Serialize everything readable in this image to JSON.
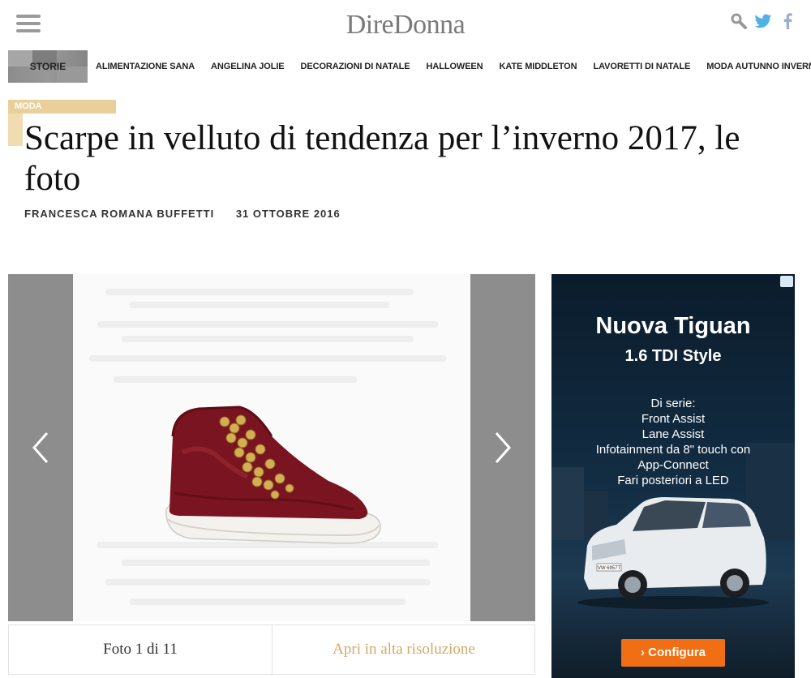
{
  "header": {
    "logo": "DireDonna",
    "icons": [
      "menu-icon",
      "search-icon",
      "twitter-icon",
      "facebook-icon"
    ]
  },
  "nav": {
    "storie": "STORIE",
    "items": [
      "ALIMENTAZIONE SANA",
      "ANGELINA JOLIE",
      "DECORAZIONI DI NATALE",
      "HALLOWEEN",
      "KATE MIDDLETON",
      "LAVORETTI DI NATALE",
      "MODA AUTUNNO INVERNO"
    ]
  },
  "article": {
    "category": "MODA",
    "title": "Scarpe in velluto di tendenza per l’inverno 2017, le foto",
    "author": "FRANCESCA ROMANA BUFFETTI",
    "date": "31 OTTOBRE 2016"
  },
  "gallery": {
    "counter": "Foto 1 di 11",
    "hires": "Apri in alta risoluzione"
  },
  "ad": {
    "title": "Nuova Tiguan",
    "subtitle": "1.6 TDI Style",
    "lines": [
      "Di serie:",
      "Front Assist",
      "Lane Assist",
      "Infotainment da 8\" touch con",
      "App-Connect",
      "Fari posteriori a LED"
    ],
    "plate": "VW 6957T",
    "cta": "Configura"
  },
  "colors": {
    "accent": "#d0a96a",
    "category": "#e9cf9a",
    "arrow_bg": "#8d8d8d",
    "cta": "#f06e14"
  }
}
